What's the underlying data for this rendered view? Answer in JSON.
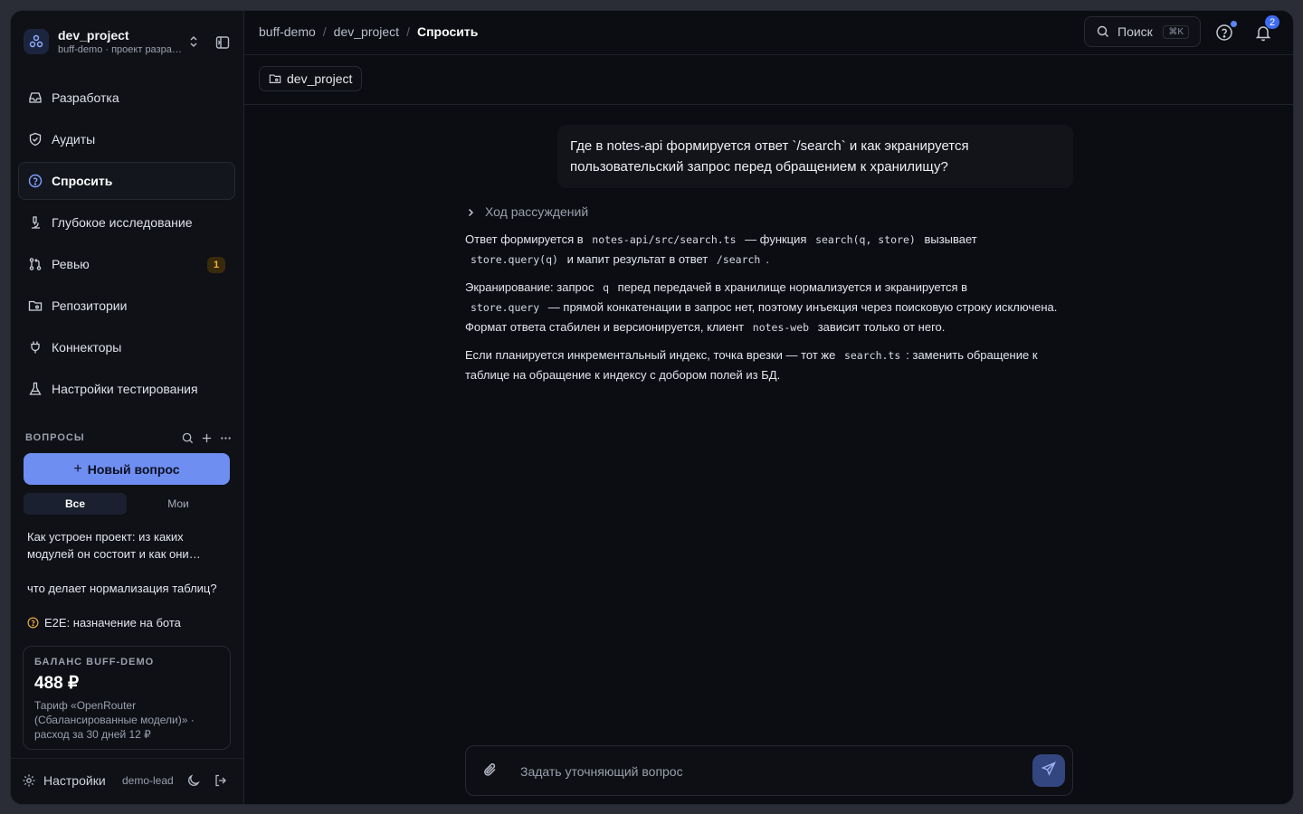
{
  "project": {
    "name": "dev_project",
    "subtitle": "buff-demo · проект разработки"
  },
  "nav": [
    {
      "label": "Разработка",
      "icon": "inbox-icon"
    },
    {
      "label": "Аудиты",
      "icon": "shield-icon"
    },
    {
      "label": "Спросить",
      "icon": "question-circle-icon",
      "active": true
    },
    {
      "label": "Глубокое исследование",
      "icon": "microscope-icon"
    },
    {
      "label": "Ревью",
      "icon": "git-pull-request-icon",
      "badge": "1"
    },
    {
      "label": "Репозитории",
      "icon": "folder-git-icon"
    },
    {
      "label": "Коннекторы",
      "icon": "plug-icon"
    },
    {
      "label": "Настройки тестирования",
      "icon": "flask-icon"
    }
  ],
  "questions": {
    "title": "ВОПРОСЫ",
    "new_button": "Новый вопрос",
    "tabs": [
      "Все",
      "Мои"
    ],
    "items": [
      "Как устроен проект: из каких модулей он состоит и как они связаны?",
      "что делает нормализация таблиц?",
      "E2E: назначение на бота"
    ]
  },
  "balance": {
    "label": "БАЛАНС BUFF-DEMO",
    "value": "488 ₽",
    "note": "Тариф «OpenRouter (Сбалансированные модели)» · расход за 30 дней 12 ₽"
  },
  "footer": {
    "settings": "Настройки",
    "user": "demo-lead"
  },
  "breadcrumbs": [
    "buff-demo",
    "dev_project",
    "Спросить"
  ],
  "topbar": {
    "search_label": "Поиск",
    "shortcut": "⌘K",
    "notifications_count": "2"
  },
  "repo_chip": "dev_project",
  "chat": {
    "user_message": "Где в notes-api формируется ответ `/search` и как экранируется пользовательский запрос перед обращением к хранилищу?",
    "reasoning_label": "Ход рассуждений",
    "answer": {
      "p1": [
        "Ответ формируется в",
        "notes-api/src/search.ts",
        "— функция",
        "search(q, store)",
        "вызывает",
        "store.query(q)",
        "и мапит результат в ответ",
        "/search",
        "."
      ],
      "p2": [
        "Экранирование: запрос",
        "q",
        "перед передачей в хранилище нормализуется и экранируется в",
        "store.query",
        "— прямой конкатенации в запрос нет, поэтому инъекция через поисковую строку исключена. Формат ответа стабилен и версионируется, клиент",
        "notes-web",
        "зависит только от него."
      ],
      "p3": [
        "Если планируется инкрементальный индекс, точка врезки — тот же",
        "search.ts",
        ": заменить обращение к таблице на обращение к индексу с добором полей из БД."
      ]
    },
    "composer_placeholder": "Задать уточняющий вопрос"
  },
  "colors": {
    "accent": "#6f8ef2",
    "send_button": "#34467f",
    "badge_bg": "#3a2a0c",
    "badge_text": "#f3b23c"
  }
}
